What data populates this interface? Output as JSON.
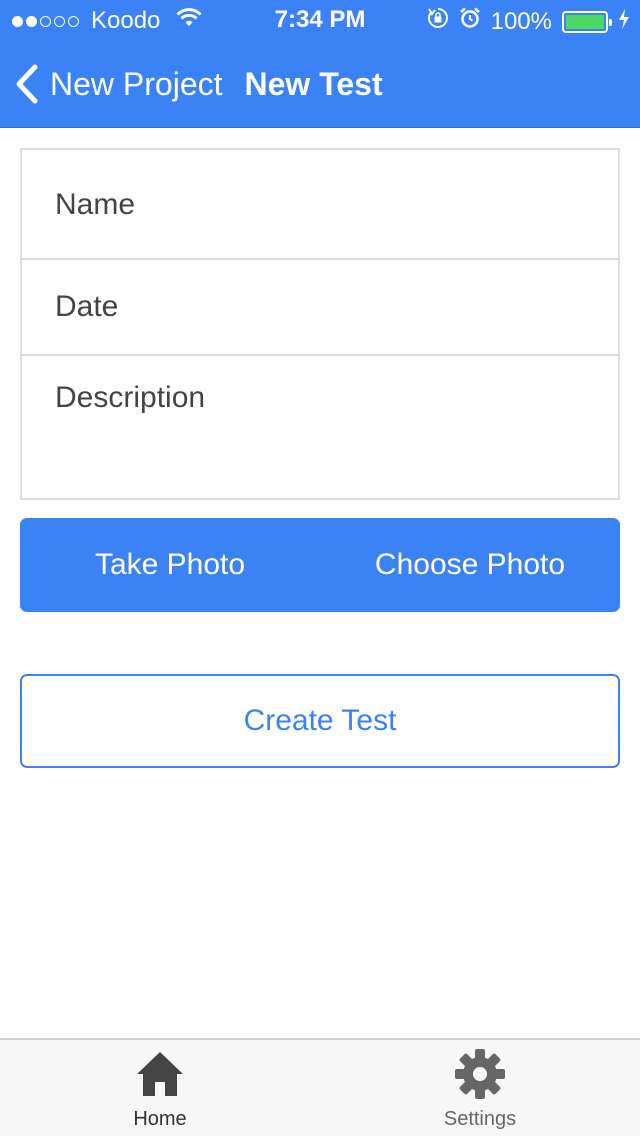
{
  "status_bar": {
    "carrier": "Koodo",
    "time": "7:34 PM",
    "battery": "100%",
    "signal_strength": 2,
    "signal_total": 5,
    "battery_level": 1.0,
    "battery_color": "#4cd964"
  },
  "nav": {
    "back_label": "New Project",
    "title": "New Test",
    "background_color": "#3b82f6"
  },
  "form": {
    "name_placeholder": "Name",
    "date_placeholder": "Date",
    "description_placeholder": "Description"
  },
  "photo_actions": {
    "take_label": "Take Photo",
    "choose_label": "Choose Photo"
  },
  "create_label": "Create Test",
  "tab_bar": {
    "tabs": [
      {
        "label": "Home",
        "icon": "home-icon",
        "active": true
      },
      {
        "label": "Settings",
        "icon": "gear-icon",
        "active": false
      }
    ]
  }
}
